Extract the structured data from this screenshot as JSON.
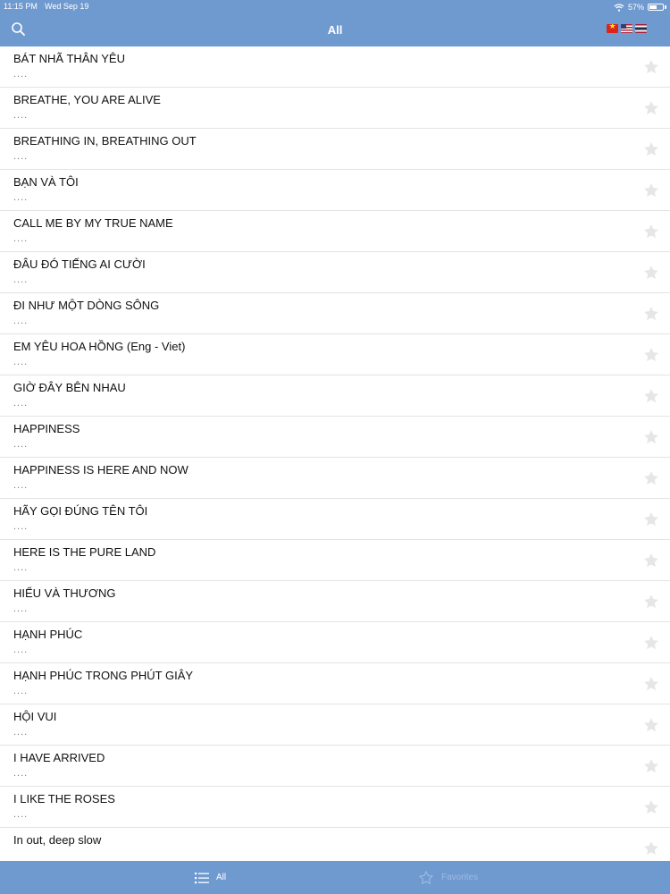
{
  "status_bar": {
    "time": "11:15 PM",
    "date": "Wed Sep 19",
    "battery_text": "57%",
    "battery_level": 0.57
  },
  "nav": {
    "title": "All",
    "icons": [
      "search-icon",
      "flag-vietnam-icon",
      "flag-usa-icon",
      "flag-thailand-icon"
    ]
  },
  "songs": [
    {
      "title": "BÁT NHÃ THÂN YÊU",
      "subtitle": "...."
    },
    {
      "title": "BREATHE, YOU ARE ALIVE",
      "subtitle": "...."
    },
    {
      "title": "BREATHING IN, BREATHING OUT",
      "subtitle": "...."
    },
    {
      "title": "BẠN VÀ TÔI",
      "subtitle": "...."
    },
    {
      "title": "CALL ME BY MY TRUE NAME",
      "subtitle": "...."
    },
    {
      "title": "ĐÂU ĐÓ TIẾNG AI CƯỜI",
      "subtitle": "...."
    },
    {
      "title": "ĐI NHƯ MỘT DÒNG SÔNG",
      "subtitle": "...."
    },
    {
      "title": "EM YÊU HOA HỒNG (Eng - Viet)",
      "subtitle": "...."
    },
    {
      "title": "GIỜ ĐÂY BÊN NHAU",
      "subtitle": "...."
    },
    {
      "title": "HAPPINESS",
      "subtitle": "...."
    },
    {
      "title": "HAPPINESS IS HERE AND NOW",
      "subtitle": "...."
    },
    {
      "title": "HÃY GỌI ĐÚNG TÊN TÔI",
      "subtitle": "...."
    },
    {
      "title": "HERE IS THE PURE LAND",
      "subtitle": "...."
    },
    {
      "title": "HIỂU VÀ THƯƠNG",
      "subtitle": "...."
    },
    {
      "title": "HẠNH PHÚC",
      "subtitle": "...."
    },
    {
      "title": "HẠNH PHÚC TRONG PHÚT GIÂY",
      "subtitle": "...."
    },
    {
      "title": "HỘI VUI",
      "subtitle": "...."
    },
    {
      "title": "I HAVE ARRIVED",
      "subtitle": "...."
    },
    {
      "title": "I LIKE THE ROSES",
      "subtitle": "...."
    },
    {
      "title": "In out, deep slow",
      "subtitle": ""
    }
  ],
  "tabbar": {
    "all_label": "All",
    "favorites_label": "Favorites",
    "active_tab": "All"
  },
  "colors": {
    "bar": "#6f9ad0",
    "star_inactive": "#e6e6e6",
    "text": "#111111"
  }
}
